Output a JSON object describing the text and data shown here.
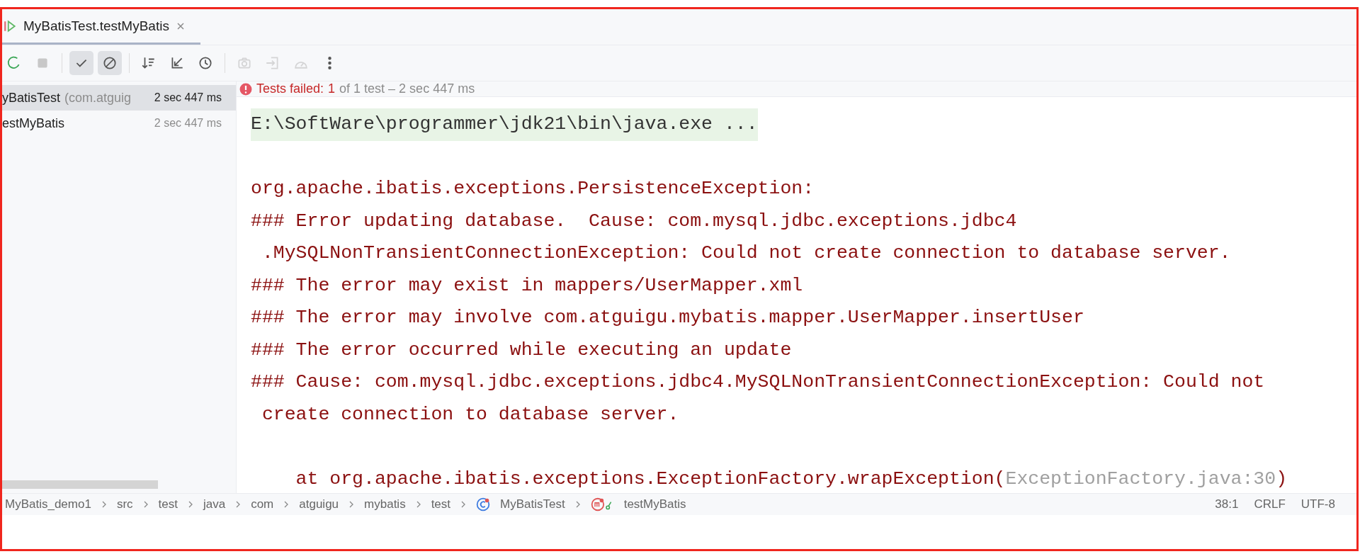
{
  "tab": {
    "title": "MyBatisTest.testMyBatis",
    "selected": true
  },
  "toolbar": [
    {
      "kind": "rerun",
      "on": false,
      "disabled": false
    },
    {
      "kind": "stop",
      "on": false,
      "disabled": false
    },
    {
      "kind": "check",
      "on": true,
      "disabled": false
    },
    {
      "kind": "ban",
      "on": true,
      "disabled": false
    },
    {
      "kind": "sort",
      "on": false,
      "disabled": false
    },
    {
      "kind": "collapse",
      "on": false,
      "disabled": false
    },
    {
      "kind": "clock",
      "on": false,
      "disabled": false
    },
    {
      "kind": "camera",
      "on": false,
      "disabled": true
    },
    {
      "kind": "import",
      "on": false,
      "disabled": true
    },
    {
      "kind": "gauge",
      "on": false,
      "disabled": true
    },
    {
      "kind": "more",
      "on": false,
      "disabled": false
    }
  ],
  "tree": [
    {
      "name": "yBatisTest",
      "package": "(com.atguig",
      "time": "2 sec 447 ms",
      "selected": true
    },
    {
      "name": "estMyBatis",
      "time": "2 sec 447 ms",
      "selected": false
    }
  ],
  "summary": {
    "label": "Tests failed:",
    "failed": "1",
    "rest": "of 1 test – 2 sec 447 ms"
  },
  "console": [
    {
      "kind": "command",
      "text": "E:\\SoftWare\\programmer\\jdk21\\bin\\java.exe ..."
    },
    {
      "kind": "blank"
    },
    {
      "kind": "error",
      "text": "org.apache.ibatis.exceptions.PersistenceException:"
    },
    {
      "kind": "error",
      "text": "### Error updating database.  Cause: com.mysql.jdbc.exceptions.jdbc4"
    },
    {
      "kind": "error",
      "text": " .MySQLNonTransientConnectionException: Could not create connection to database server."
    },
    {
      "kind": "error",
      "text": "### The error may exist in mappers/UserMapper.xml"
    },
    {
      "kind": "error",
      "text": "### The error may involve com.atguigu.mybatis.mapper.UserMapper.insertUser"
    },
    {
      "kind": "error",
      "text": "### The error occurred while executing an update"
    },
    {
      "kind": "error",
      "text": "### Cause: com.mysql.jdbc.exceptions.jdbc4.MySQLNonTransientConnectionException: Could not"
    },
    {
      "kind": "error",
      "text": " create connection to database server."
    },
    {
      "kind": "blank"
    },
    {
      "kind": "trace",
      "text": "    at org.apache.ibatis.exceptions.ExceptionFactory.wrapException(",
      "link": "ExceptionFactory.java:30",
      "end": ")"
    }
  ],
  "breadcrumbs": [
    {
      "kind": "plain",
      "label": "MyBatis_demo1"
    },
    {
      "kind": "plain",
      "label": "src"
    },
    {
      "kind": "plain",
      "label": "test"
    },
    {
      "kind": "plain",
      "label": "java"
    },
    {
      "kind": "plain",
      "label": "com"
    },
    {
      "kind": "plain",
      "label": "atguigu"
    },
    {
      "kind": "plain",
      "label": "mybatis"
    },
    {
      "kind": "plain",
      "label": "test"
    },
    {
      "kind": "class",
      "label": "MyBatisTest"
    },
    {
      "kind": "method",
      "label": "testMyBatis"
    }
  ],
  "status": [
    "38:1",
    "CRLF",
    "UTF-8"
  ]
}
